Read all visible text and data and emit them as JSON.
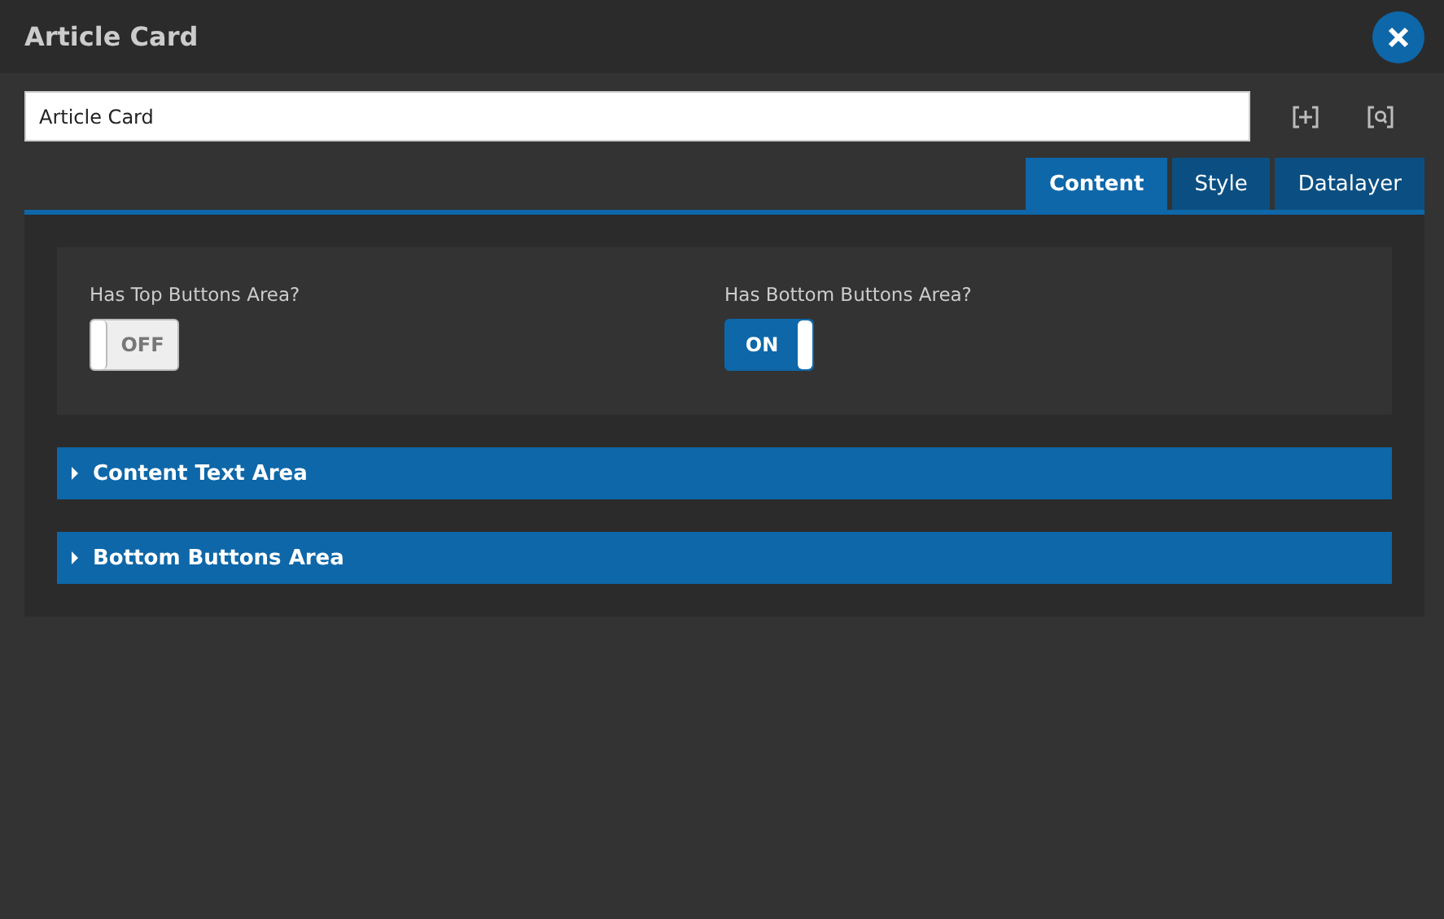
{
  "window": {
    "title": "Article Card"
  },
  "name_field": {
    "value": "Article Card"
  },
  "tabs": [
    {
      "label": "Content",
      "selected": true
    },
    {
      "label": "Style",
      "selected": false
    },
    {
      "label": "Datalayer",
      "selected": false
    }
  ],
  "toggles": [
    {
      "label": "Has Top Buttons Area?",
      "on": false,
      "text": "OFF"
    },
    {
      "label": "Has Bottom Buttons Area?",
      "on": true,
      "text": "ON"
    }
  ],
  "sections": [
    {
      "title": "Content Text Area",
      "expanded": false
    },
    {
      "title": "Bottom Buttons Area",
      "expanded": false
    }
  ]
}
